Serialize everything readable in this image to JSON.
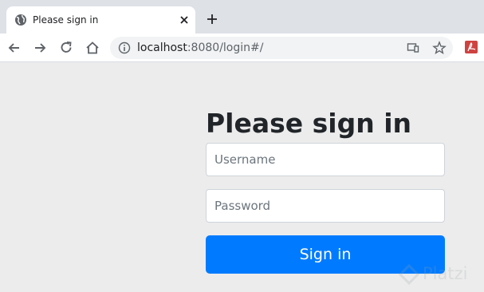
{
  "browser": {
    "tab_title": "Please sign in",
    "url_host": "localhost",
    "url_rest": ":8080/login#/",
    "icons": {
      "tab_favicon": "globe-icon",
      "tab_close": "close-icon",
      "new_tab": "plus-icon",
      "back": "arrow-left-icon",
      "forward": "arrow-right-icon",
      "reload": "reload-icon",
      "home": "home-icon",
      "site_info": "info-icon",
      "cast": "cast-icon",
      "bookmark": "star-icon",
      "extension": "pdf-extension-icon"
    }
  },
  "login": {
    "heading": "Please sign in",
    "username_placeholder": "Username",
    "password_placeholder": "Password",
    "submit_label": "Sign in"
  },
  "watermark": {
    "text": "Platzi"
  },
  "colors": {
    "primary_button": "#007bff",
    "page_background": "#ececec",
    "tabstrip": "#dee1e6"
  }
}
